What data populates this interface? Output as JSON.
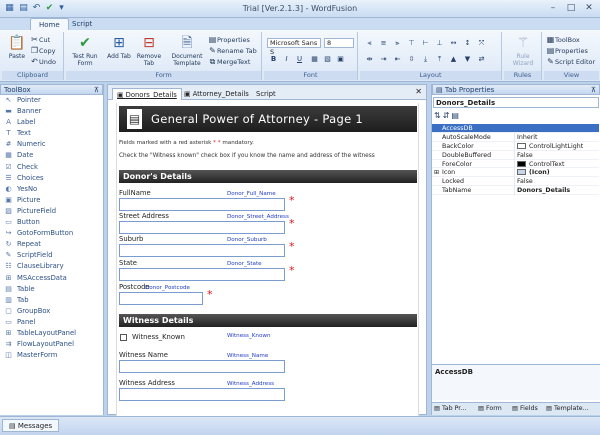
{
  "window": {
    "title": "Trial [Ver.2.1.3] - WordFusion"
  },
  "ribbon": {
    "tabs": [
      "Home",
      "Script"
    ],
    "clipboard": {
      "paste": "Paste",
      "cut": "Cut",
      "copy": "Copy",
      "undo": "Undo",
      "label": "Clipboard"
    },
    "form": {
      "test_run": "Test Run Form",
      "add_tab": "Add Tab",
      "remove_tab": "Remove Tab",
      "document_template": "Document Template",
      "properties": "Properties",
      "rename_tab": "Rename Tab",
      "merge_text": "MergeText",
      "label": "Form"
    },
    "font": {
      "family": "Microsoft Sans S",
      "size": "8",
      "bold": "B",
      "italic": "I",
      "underline": "U",
      "label": "Font"
    },
    "layout": {
      "label": "Layout"
    },
    "rules": {
      "rule_wizard": "Rule Wizard",
      "label": "Rules"
    },
    "view": {
      "toolbox": "ToolBox",
      "properties": "Properties",
      "script_editor": "Script Editor",
      "label": "View"
    }
  },
  "toolbox": {
    "title": "ToolBox",
    "items": [
      "Pointer",
      "Banner",
      "Label",
      "Text",
      "Numeric",
      "Date",
      "Check",
      "Choices",
      "YesNo",
      "Picture",
      "PictureField",
      "Button",
      "GotoFormButton",
      "Repeat",
      "ScriptField",
      "ClauseLibrary",
      "MSAccessData",
      "Table",
      "Tab",
      "GroupBox",
      "Panel",
      "TableLayoutPanel",
      "FlowLayoutPanel",
      "MasterForm"
    ]
  },
  "document": {
    "tabs": [
      "Donors_Details",
      "Attorney_Details",
      "Script"
    ],
    "banner_title": "General Power of Attorney  -  Page 1",
    "note1": "Fields marked with a red asterisk",
    "note1_star": "*",
    "note1_end": "mandatory.",
    "note2": "Check the \"Witness known\" check box if you know the name and address of the witness",
    "section1": "Donor's Details",
    "section2": "Witness Details",
    "fields": [
      {
        "label": "FullName",
        "name": "Donor_Full_Name"
      },
      {
        "label": "Street Address",
        "name": "Donor_Street_Address"
      },
      {
        "label": "Suburb",
        "name": "Donor_Suburb"
      },
      {
        "label": "State",
        "name": "Donor_State"
      },
      {
        "label": "Postcode",
        "name": "Donor_Postcode"
      }
    ],
    "witness_known": {
      "label": "Witness_Known",
      "name": "Witness_Known"
    },
    "witness_fields": [
      {
        "label": "Witness Name",
        "name": "Witness_Name"
      },
      {
        "label": "Witness Address",
        "name": "Witness_Address"
      }
    ],
    "required_mark": "*"
  },
  "properties": {
    "title": "Tab Properties",
    "object": "Donors_Details",
    "rows": [
      {
        "name": "AccessDB",
        "value": ""
      },
      {
        "name": "AutoScaleMode",
        "value": "Inherit"
      },
      {
        "name": "BackColor",
        "value": "ControlLightLight",
        "swatch": "#ffffff"
      },
      {
        "name": "DoubleBuffered",
        "value": "False"
      },
      {
        "name": "ForeColor",
        "value": "ControlText",
        "swatch": "#000000"
      },
      {
        "name": "Icon",
        "value": "(Icon)",
        "swatch": "#c8d4e8"
      },
      {
        "name": "Locked",
        "value": "False"
      },
      {
        "name": "TabName",
        "value": "Donors_Details"
      }
    ],
    "description_title": "AccessDB",
    "bottom_tabs": [
      "Tab Pr...",
      "Form",
      "Fields",
      "Template..."
    ]
  },
  "status": {
    "messages": "Messages"
  },
  "colors": {
    "accent": "#2b5ea0",
    "required": "#e0101e",
    "field_name": "#1f3cc7"
  }
}
